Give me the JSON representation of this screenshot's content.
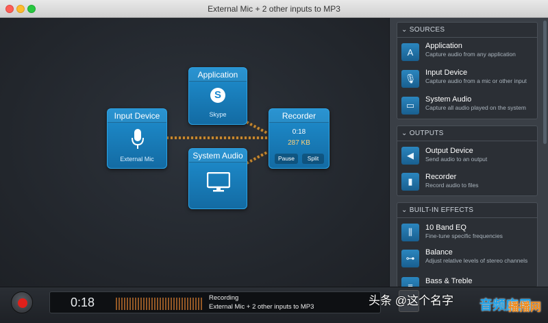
{
  "window": {
    "title": "External Mic + 2 other inputs to MP3"
  },
  "nodes": {
    "input_device": {
      "title": "Input Device",
      "sub": "External Mic",
      "icon": "microphone-icon"
    },
    "application": {
      "title": "Application",
      "sub": "Skype",
      "icon": "skype-icon"
    },
    "system_audio": {
      "title": "System Audio",
      "icon": "monitor-icon"
    },
    "recorder": {
      "title": "Recorder",
      "time": "0:18",
      "size": "287 KB",
      "pause_label": "Pause",
      "split_label": "Split"
    }
  },
  "sidebar": {
    "sources": {
      "header": "SOURCES",
      "items": [
        {
          "title": "Application",
          "desc": "Capture audio from any application",
          "icon": "app-store-icon"
        },
        {
          "title": "Input Device",
          "desc": "Capture audio from a mic or other input",
          "icon": "microphone-icon"
        },
        {
          "title": "System Audio",
          "desc": "Capture all audio played on the system",
          "icon": "monitor-icon"
        }
      ]
    },
    "outputs": {
      "header": "OUTPUTS",
      "items": [
        {
          "title": "Output Device",
          "desc": "Send audio to an output",
          "icon": "speaker-icon"
        },
        {
          "title": "Recorder",
          "desc": "Record audio to files",
          "icon": "document-icon"
        }
      ]
    },
    "effects": {
      "header": "BUILT-IN EFFECTS",
      "items": [
        {
          "title": "10 Band EQ",
          "desc": "Fine-tune specific frequencies",
          "icon": "equalizer-icon"
        },
        {
          "title": "Balance",
          "desc": "Adjust relative levels of stereo channels",
          "icon": "balance-icon"
        },
        {
          "title": "Bass & Treble",
          "desc": "",
          "icon": "bass-treble-icon"
        }
      ]
    }
  },
  "bottom": {
    "timer": "0:18",
    "status": "Recording",
    "detail": "External Mic + 2 other inputs to MP3"
  },
  "watermark": {
    "text": "头条 @这个名字",
    "logo": "音频应用",
    "logo2": "播播网"
  },
  "colors": {
    "node_blue": "#1a80c0",
    "wire": "#c7882f",
    "record_red": "#e0201b"
  }
}
